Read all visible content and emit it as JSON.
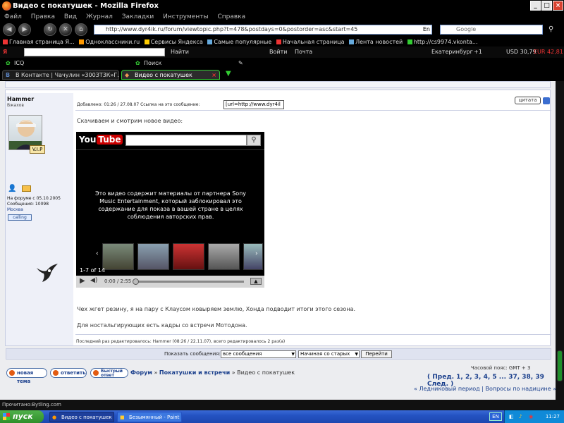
{
  "window": {
    "title": "Видео с покатушек - Mozilla Firefox"
  },
  "menu": [
    "Файл",
    "Правка",
    "Вид",
    "Журнал",
    "Закладки",
    "Инструменты",
    "Справка"
  ],
  "nav": {
    "url": "http://www.dyr4ik.ru/forum/viewtopic.php?t=478&postdays=0&postorder=asc&start=45",
    "url_lang": "En",
    "search_placeholder": "Google"
  },
  "bookmarks": [
    "Главная страница Я...",
    "Одноклассники.ru",
    "Сервисы Яндекса",
    "Самые популярные",
    "Начальная страница",
    "Лента новостей",
    "http://cs9974.vkonta..."
  ],
  "yandex": {
    "find_label": "Найти",
    "city": "Екатеринбург",
    "temp": "+1",
    "usd": "USD 30,79",
    "eur": "EUR 42,81",
    "sign_in": "Войти",
    "mail": "Почта"
  },
  "icq": {
    "label": "ICQ",
    "search_label": "Поиск"
  },
  "tabs": [
    {
      "label": "В Контакте | Чачулин «300ЗТ3К»Г..."
    },
    {
      "label": "Видео с покатушек"
    }
  ],
  "post": {
    "author": "Hammer",
    "rank": "Вжахов",
    "vip": "V.I.P",
    "joined": "На форуме с 05.10.2005",
    "messages": "Сообщения: 10098",
    "location": "Москва",
    "skype": "calling",
    "header": "Добавлено: 01:26 / 27.08.07  Ссылка на это сообщение:",
    "link_value": "[url=http://www.dyr4il",
    "quote_label": "цитата",
    "intro": "Скачиваем и смотрим новое видео:",
    "line1": "Чех жгет резину, я на пару с Клаусом ковыряем землю, Хонда подводит итоги этого сезона.",
    "line2": "Для ностальгирующих есть кадры со встречи Мотодона.",
    "edited": "Последний раз редактировалось: Hammer (08:26 / 22.11.07), всего редактировалось 2 раз(а)"
  },
  "video": {
    "logo_you": "You",
    "logo_tube": "Tube",
    "message": "Это видео содержит материалы от партнера Sony Music Entertainment, который заблокировал это содержание для показа в вашей стране в целях соблюдения авторских прав.",
    "count": "1-7 of 14",
    "time": "0:00 / 2:55"
  },
  "sort": {
    "label": "Показать сообщения:",
    "range": "все сообщения",
    "order": "Начиная со старых",
    "go": "Перейти"
  },
  "footer": {
    "new_topic": "новая тема",
    "reply": "ответить",
    "quick_reply": "Быстрый ответ",
    "crumb_forum": "Форум",
    "crumb_sep1": " » ",
    "crumb_section": "Покатушки и встречи",
    "crumb_sep2": " » ",
    "crumb_topic": "Видео с покатушек",
    "timezone": "Часовой пояс: GMT + 3",
    "pages": "( Пред. 1, 2, 3, 4, 5 ... 37, 38, 39 След. )",
    "prev_next": "« Ледниковый период | Вопросы по надицине »"
  },
  "status": "Прочитано:Bytling.com",
  "taskbar": {
    "start": "пуск",
    "tasks": [
      "Видео с покатушек ...",
      "Безымянный - Paint"
    ],
    "lang": "EN",
    "clock": "11:27"
  }
}
